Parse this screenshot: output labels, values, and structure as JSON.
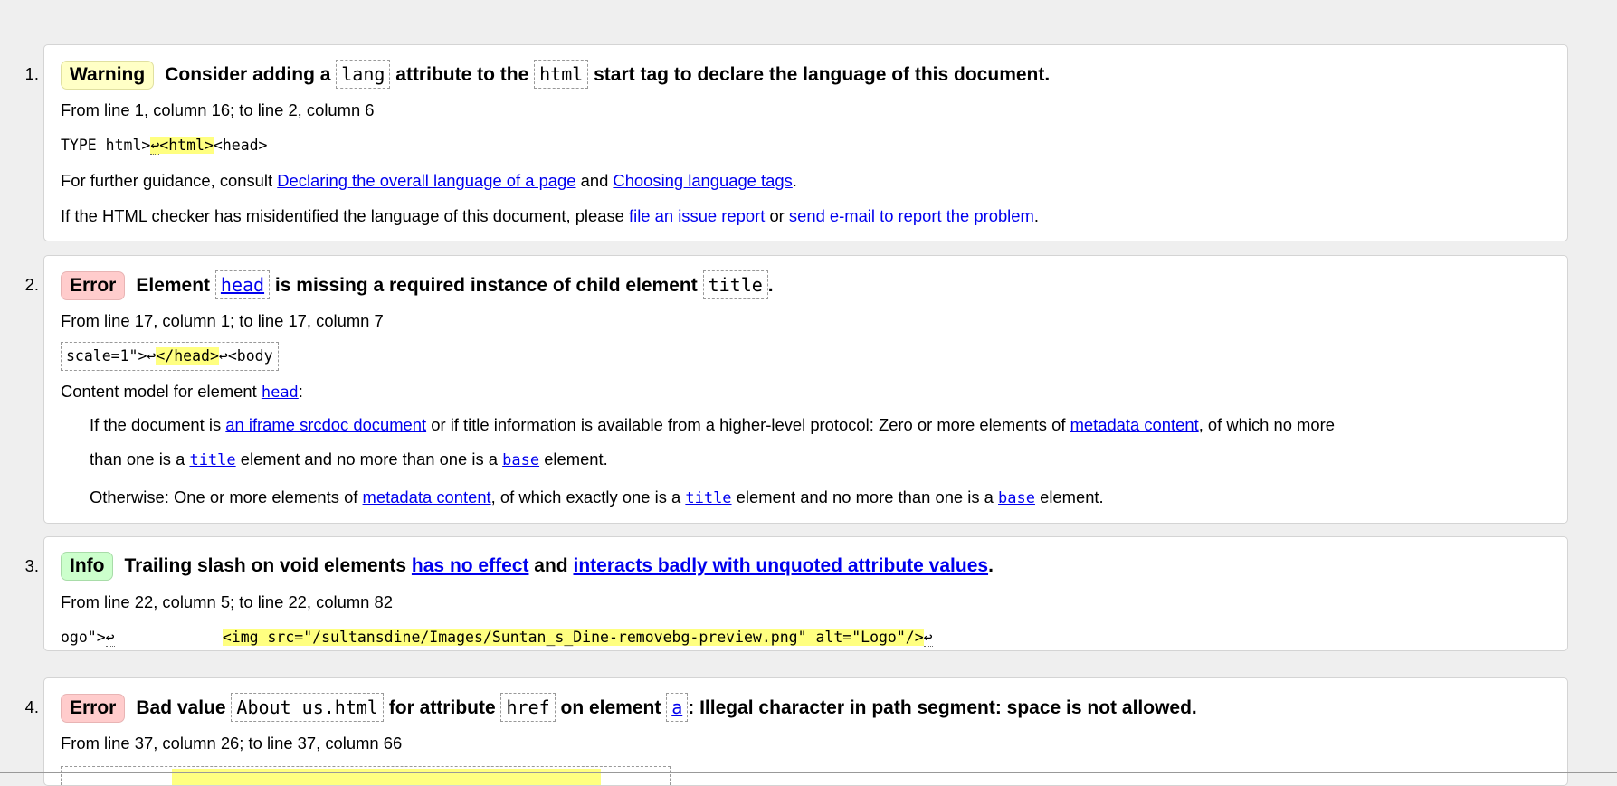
{
  "messages": [
    {
      "number": "1.",
      "type": "Warning",
      "heading": [
        "Consider adding a",
        "lang",
        "attribute to the",
        "html",
        "start tag to declare the language of this document."
      ],
      "location": "From line 1, column 16; to line 2, column 6",
      "code": {
        "before": "TYPE html>",
        "lf": "↩",
        "highlight": "<html>",
        "after": "<head>"
      },
      "guidance": {
        "prefix": "For further guidance, consult",
        "link1": "Declaring the overall language of a page",
        "mid": "and",
        "link2": "Choosing language tags",
        "suffix": "."
      },
      "report": {
        "prefix": "If the HTML checker has misidentified the language of this document, please",
        "link1": "file an issue report",
        "mid": "or",
        "link2": "send e-mail to report the problem",
        "suffix": "."
      }
    },
    {
      "number": "2.",
      "type": "Error",
      "heading": [
        "Element",
        "head",
        "is missing a required instance of child element",
        "title",
        "."
      ],
      "location": "From line 17, column 1; to line 17, column 7",
      "code": {
        "before": "scale=1\">",
        "lf": "↩",
        "highlight": "</head>",
        "lf2": "↩",
        "after": "<body"
      },
      "content_model": {
        "prefix": "Content model for element",
        "link": "head",
        "suffix": ":"
      },
      "cm_line1": {
        "a": "If the document is",
        "link1": "an iframe srcdoc document",
        "b": "or if title information is available from a higher-level protocol: Zero or more elements of",
        "link2": "metadata content",
        "c": ", of which no more"
      },
      "cm_line2": {
        "a": "than one is a",
        "link1": "title",
        "b": "element and no more than one is a",
        "link2": "base",
        "c": "element."
      },
      "cm_line3": {
        "a": "Otherwise: One or more elements of",
        "link1": "metadata content",
        "b": ", of which exactly one is a",
        "link2": "title",
        "c": "element and no more than one is a",
        "link3": "base",
        "d": "element."
      }
    },
    {
      "number": "3.",
      "type": "Info",
      "heading": [
        "Trailing slash on void elements",
        "has no effect",
        "and",
        "interacts badly with unquoted attribute values",
        "."
      ],
      "location": "From line 22, column 5; to line 22, column 82",
      "code": {
        "before": "ogo\">",
        "lf": "↩",
        "spaces": "            ",
        "highlight": "<img src=\"/sultansdine/Images/Suntan_s_Dine-removebg-preview.png\" alt=\"Logo\"/>",
        "lf2": "↩"
      }
    },
    {
      "number": "4.",
      "type": "Error",
      "heading": [
        "Bad value",
        "About us.html",
        "for attribute",
        "href",
        "on element",
        "a",
        ": Illegal character in path segment: space is not allowed."
      ],
      "location": "From line 37, column 26; to line 37, column 66"
    }
  ],
  "colors": {
    "warning_bg": "#ffffc6",
    "error_bg": "#ffcccc",
    "info_bg": "#ccffcc",
    "link": "#0000ee",
    "highlight": "#ffff80"
  }
}
